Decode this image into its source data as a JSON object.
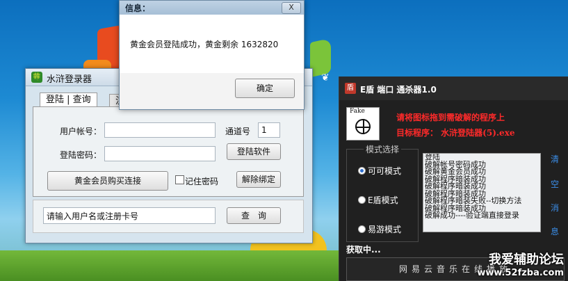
{
  "info_dialog": {
    "title": "信息：",
    "close": "X",
    "message": "黄金会员登陆成功，黄金剩余 1632820",
    "ok_button": "确定"
  },
  "login_window": {
    "icon": "🍀",
    "title": "水浒登录器",
    "tab_login": "登陆 | 查询",
    "tab_other": "注",
    "account_label": "用户帐号：",
    "account_value": "",
    "channel_label": "通道号",
    "channel_value": "1",
    "password_label": "登陆密码：",
    "password_value": "",
    "login_button": "登陆软件",
    "buy_button": "黄金会员购买连接",
    "remember_label": "记住密码",
    "unbind_button": "解除绑定",
    "query_input": "请输入用户名或注册卡号",
    "query_button": "查　询"
  },
  "tool_window": {
    "title": "E盾 端口 通杀器1.0",
    "fake_label": "Fake",
    "hint": "请将图标拖到需破解的程序上",
    "target": "目标程序：  水浒登陆器(5).exe",
    "mode_group_title": "模式选择",
    "modes": [
      {
        "label": "可可模式",
        "selected": true
      },
      {
        "label": "E盾模式",
        "selected": false
      },
      {
        "label": "易游模式",
        "selected": false
      }
    ],
    "log_lines": [
      "登陆",
      "破解帐号密码成功",
      "破解黄金会员成功",
      "破解程序暗装成功",
      "破解程序暗装成功",
      "破解程序暗装成功",
      "破解程序暗装失败--切换方法",
      "破解程序暗装成功",
      "破解成功----验证端直接登录"
    ],
    "side_buttons": [
      "清",
      "空",
      "消",
      "息"
    ],
    "status": "获取中...",
    "music_button": "网易云音乐在线播放"
  },
  "watermark": {
    "line1": "我爱辅助论坛",
    "line2": "www.52fzba.com"
  },
  "colors": {
    "desktop_blue": "#1d8ad3",
    "hint_red": "#ff2a2a",
    "side_blue": "#3b8ee8"
  }
}
